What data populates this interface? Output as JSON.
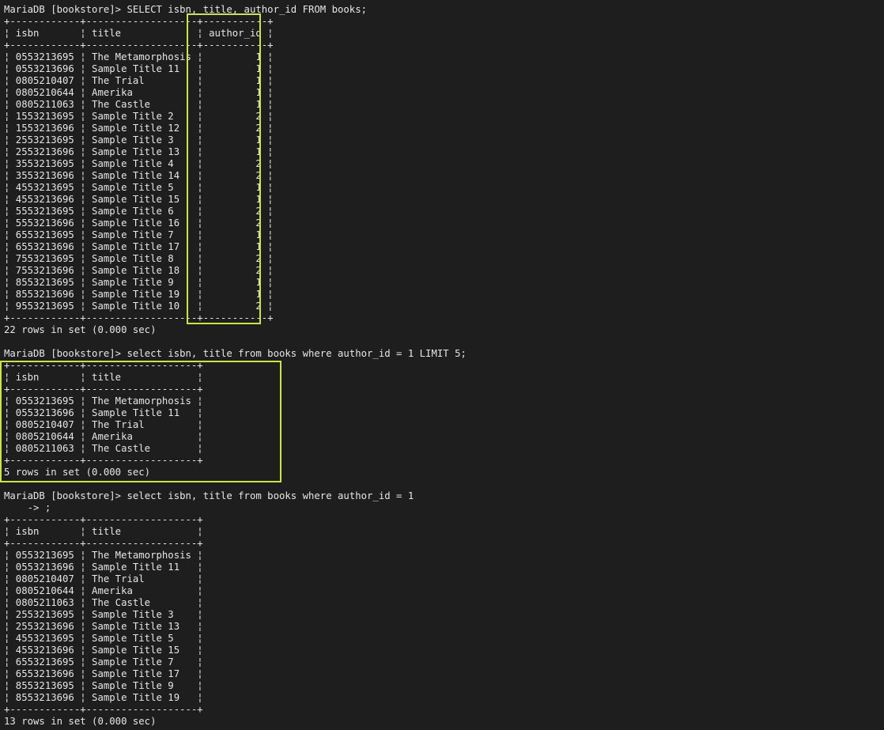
{
  "terminal": {
    "prompt": "MariaDB [bookstore]>",
    "queries": [
      {
        "command": "SELECT isbn, title, author_id FROM books;",
        "continuation": [],
        "columns": [
          {
            "name": "isbn",
            "width": 12,
            "align": "left"
          },
          {
            "name": "title",
            "width": 19,
            "align": "left"
          },
          {
            "name": "author_id",
            "width": 11,
            "align": "right"
          }
        ],
        "rows": [
          [
            "0553213695",
            "The Metamorphosis",
            "1"
          ],
          [
            "0553213696",
            "Sample Title 11",
            "1"
          ],
          [
            "0805210407",
            "The Trial",
            "1"
          ],
          [
            "0805210644",
            "Amerika",
            "1"
          ],
          [
            "0805211063",
            "The Castle",
            "1"
          ],
          [
            "1553213695",
            "Sample Title 2",
            "2"
          ],
          [
            "1553213696",
            "Sample Title 12",
            "2"
          ],
          [
            "2553213695",
            "Sample Title 3",
            "1"
          ],
          [
            "2553213696",
            "Sample Title 13",
            "1"
          ],
          [
            "3553213695",
            "Sample Title 4",
            "2"
          ],
          [
            "3553213696",
            "Sample Title 14",
            "2"
          ],
          [
            "4553213695",
            "Sample Title 5",
            "1"
          ],
          [
            "4553213696",
            "Sample Title 15",
            "1"
          ],
          [
            "5553213695",
            "Sample Title 6",
            "2"
          ],
          [
            "5553213696",
            "Sample Title 16",
            "2"
          ],
          [
            "6553213695",
            "Sample Title 7",
            "1"
          ],
          [
            "6553213696",
            "Sample Title 17",
            "1"
          ],
          [
            "7553213695",
            "Sample Title 8",
            "2"
          ],
          [
            "7553213696",
            "Sample Title 18",
            "2"
          ],
          [
            "8553213695",
            "Sample Title 9",
            "1"
          ],
          [
            "8553213696",
            "Sample Title 19",
            "1"
          ],
          [
            "9553213695",
            "Sample Title 10",
            "2"
          ]
        ],
        "summary": "22 rows in set (0.000 sec)"
      },
      {
        "command": "select isbn, title from books where author_id = 1 LIMIT 5;",
        "continuation": [],
        "columns": [
          {
            "name": "isbn",
            "width": 12,
            "align": "left"
          },
          {
            "name": "title",
            "width": 19,
            "align": "left"
          }
        ],
        "rows": [
          [
            "0553213695",
            "The Metamorphosis"
          ],
          [
            "0553213696",
            "Sample Title 11"
          ],
          [
            "0805210407",
            "The Trial"
          ],
          [
            "0805210644",
            "Amerika"
          ],
          [
            "0805211063",
            "The Castle"
          ]
        ],
        "summary": "5 rows in set (0.000 sec)"
      },
      {
        "command": "select isbn, title from books where author_id = 1",
        "continuation": [
          "    -> ;"
        ],
        "columns": [
          {
            "name": "isbn",
            "width": 12,
            "align": "left"
          },
          {
            "name": "title",
            "width": 19,
            "align": "left"
          }
        ],
        "rows": [
          [
            "0553213695",
            "The Metamorphosis"
          ],
          [
            "0553213696",
            "Sample Title 11"
          ],
          [
            "0805210407",
            "The Trial"
          ],
          [
            "0805210644",
            "Amerika"
          ],
          [
            "0805211063",
            "The Castle"
          ],
          [
            "2553213695",
            "Sample Title 3"
          ],
          [
            "2553213696",
            "Sample Title 13"
          ],
          [
            "4553213695",
            "Sample Title 5"
          ],
          [
            "4553213696",
            "Sample Title 15"
          ],
          [
            "6553213695",
            "Sample Title 7"
          ],
          [
            "6553213696",
            "Sample Title 17"
          ],
          [
            "8553213695",
            "Sample Title 9"
          ],
          [
            "8553213696",
            "Sample Title 19"
          ]
        ],
        "summary": "13 rows in set (0.000 sec)"
      }
    ],
    "colors": {
      "background": "#1e1e1e",
      "text": "#e6e6e6",
      "highlight": "#c8e63c"
    }
  }
}
